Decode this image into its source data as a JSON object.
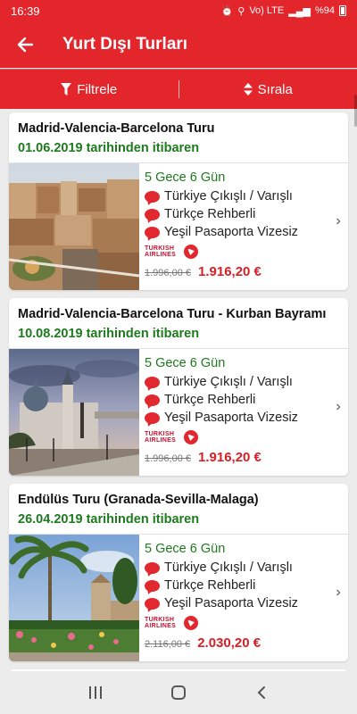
{
  "status_bar": {
    "time": "16:39",
    "network": "Vo) LTE",
    "battery": "%94"
  },
  "app_bar": {
    "title": "Yurt Dışı Turları"
  },
  "toolbar": {
    "filter_label": "Filtrele",
    "sort_label": "Sırala"
  },
  "tours": [
    {
      "title": "Madrid-Valencia-Barcelona Turu",
      "date": "01.06.2019 tarihinden itibaren",
      "nights": "5 Gece 6 Gün",
      "features": [
        "Türkiye Çıkışlı / Varışlı",
        "Türkçe Rehberli",
        "Yeşil Pasaporta Vizesiz"
      ],
      "airline": "TURKISH AIRLINES",
      "old_price": "1.996,00 €",
      "new_price": "1.916,20 €"
    },
    {
      "title": "Madrid-Valencia-Barcelona Turu - Kurban Bayramı",
      "date": "10.08.2019 tarihinden itibaren",
      "nights": "5 Gece 6 Gün",
      "features": [
        "Türkiye Çıkışlı / Varışlı",
        "Türkçe Rehberli",
        "Yeşil Pasaporta Vizesiz"
      ],
      "airline": "TURKISH AIRLINES",
      "old_price": "1.996,00 €",
      "new_price": "1.916,20 €"
    },
    {
      "title": "Endülüs Turu (Granada-Sevilla-Malaga)",
      "date": "26.04.2019 tarihinden itibaren",
      "nights": "5 Gece 6 Gün",
      "features": [
        "Türkiye Çıkışlı / Varışlı",
        "Türkçe Rehberli",
        "Yeşil Pasaporta Vizesiz"
      ],
      "airline": "TURKISH AIRLINES",
      "old_price": "2.116,00 €",
      "new_price": "2.030,20 €"
    }
  ],
  "colors": {
    "brand": "#e3262c",
    "date_green": "#1e7a1e",
    "price_red": "#d81f26"
  }
}
